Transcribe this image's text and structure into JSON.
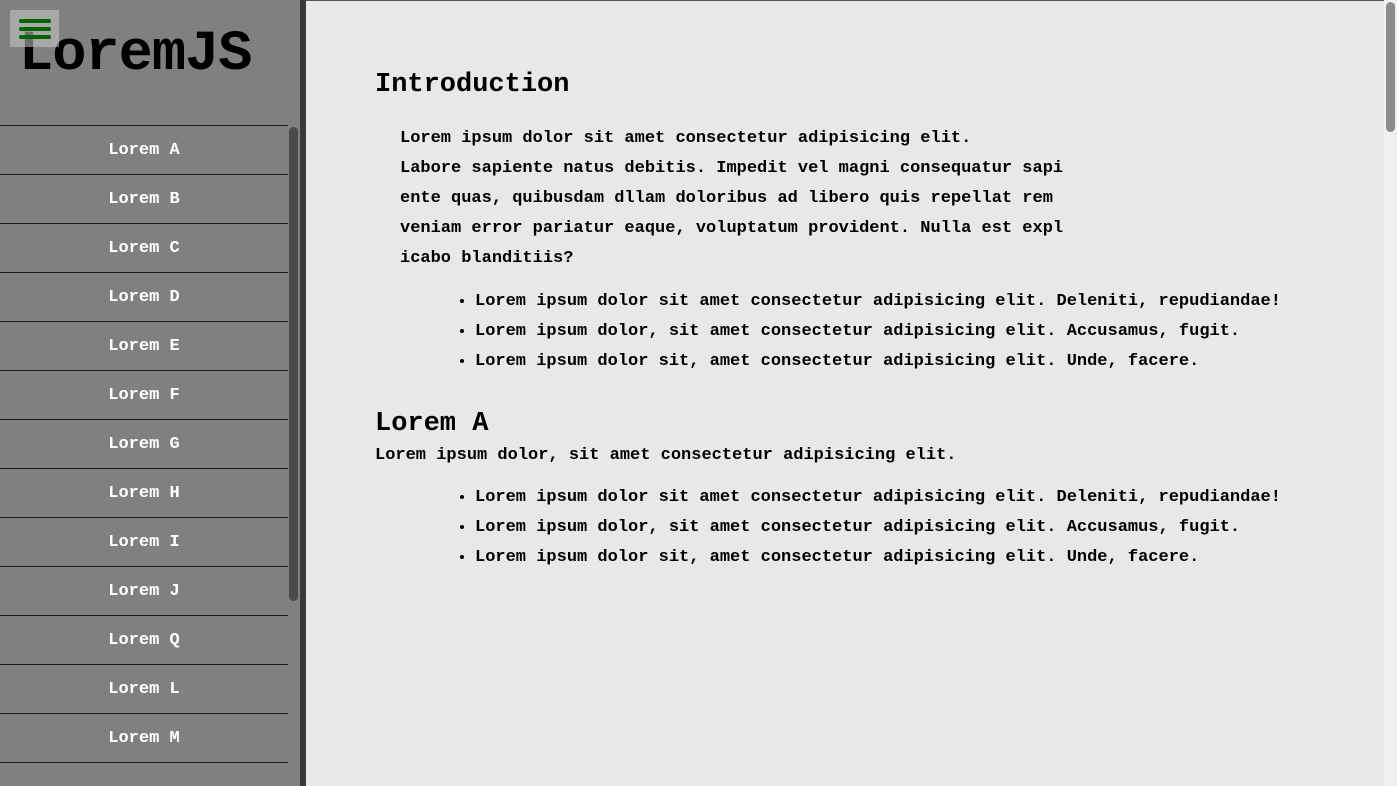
{
  "sidebar": {
    "logo": "LoremJS",
    "menu_icon": "hamburger-menu-icon",
    "menu_icon_color": "#006400",
    "background": "#808080",
    "items": [
      {
        "label": "Lorem A"
      },
      {
        "label": "Lorem B"
      },
      {
        "label": "Lorem C"
      },
      {
        "label": "Lorem D"
      },
      {
        "label": "Lorem E"
      },
      {
        "label": "Lorem F"
      },
      {
        "label": "Lorem G"
      },
      {
        "label": "Lorem H"
      },
      {
        "label": "Lorem I"
      },
      {
        "label": "Lorem J"
      },
      {
        "label": "Lorem Q"
      },
      {
        "label": "Lorem L"
      },
      {
        "label": "Lorem M"
      }
    ]
  },
  "main": {
    "intro": {
      "heading": "Introduction",
      "text": "Lorem ipsum dolor sit amet consectetur adipisicing elit.\nLabore sapiente natus debitis. Impedit vel magni consequatur sapi\nente quas, quibusdam dllam doloribus ad libero quis repellat rem\nveniam error pariatur eaque, voluptatum provident. Nulla est expl\nicabo blanditiis?",
      "bullets": [
        "Lorem ipsum dolor sit amet consectetur adipisicing elit. Deleniti, repudiandae!",
        "Lorem ipsum dolor, sit amet consectetur adipisicing elit. Accusamus, fugit.",
        "Lorem ipsum dolor sit, amet consectetur adipisicing elit. Unde, facere."
      ]
    },
    "section_a": {
      "heading": "Lorem A",
      "text": "Lorem ipsum dolor, sit amet consectetur adipisicing elit.",
      "bullets": [
        "Lorem ipsum dolor sit amet consectetur adipisicing elit. Deleniti, repudiandae!",
        "Lorem ipsum dolor, sit amet consectetur adipisicing elit. Accusamus, fugit.",
        "Lorem ipsum dolor sit, amet consectetur adipisicing elit. Unde, facere."
      ]
    }
  }
}
